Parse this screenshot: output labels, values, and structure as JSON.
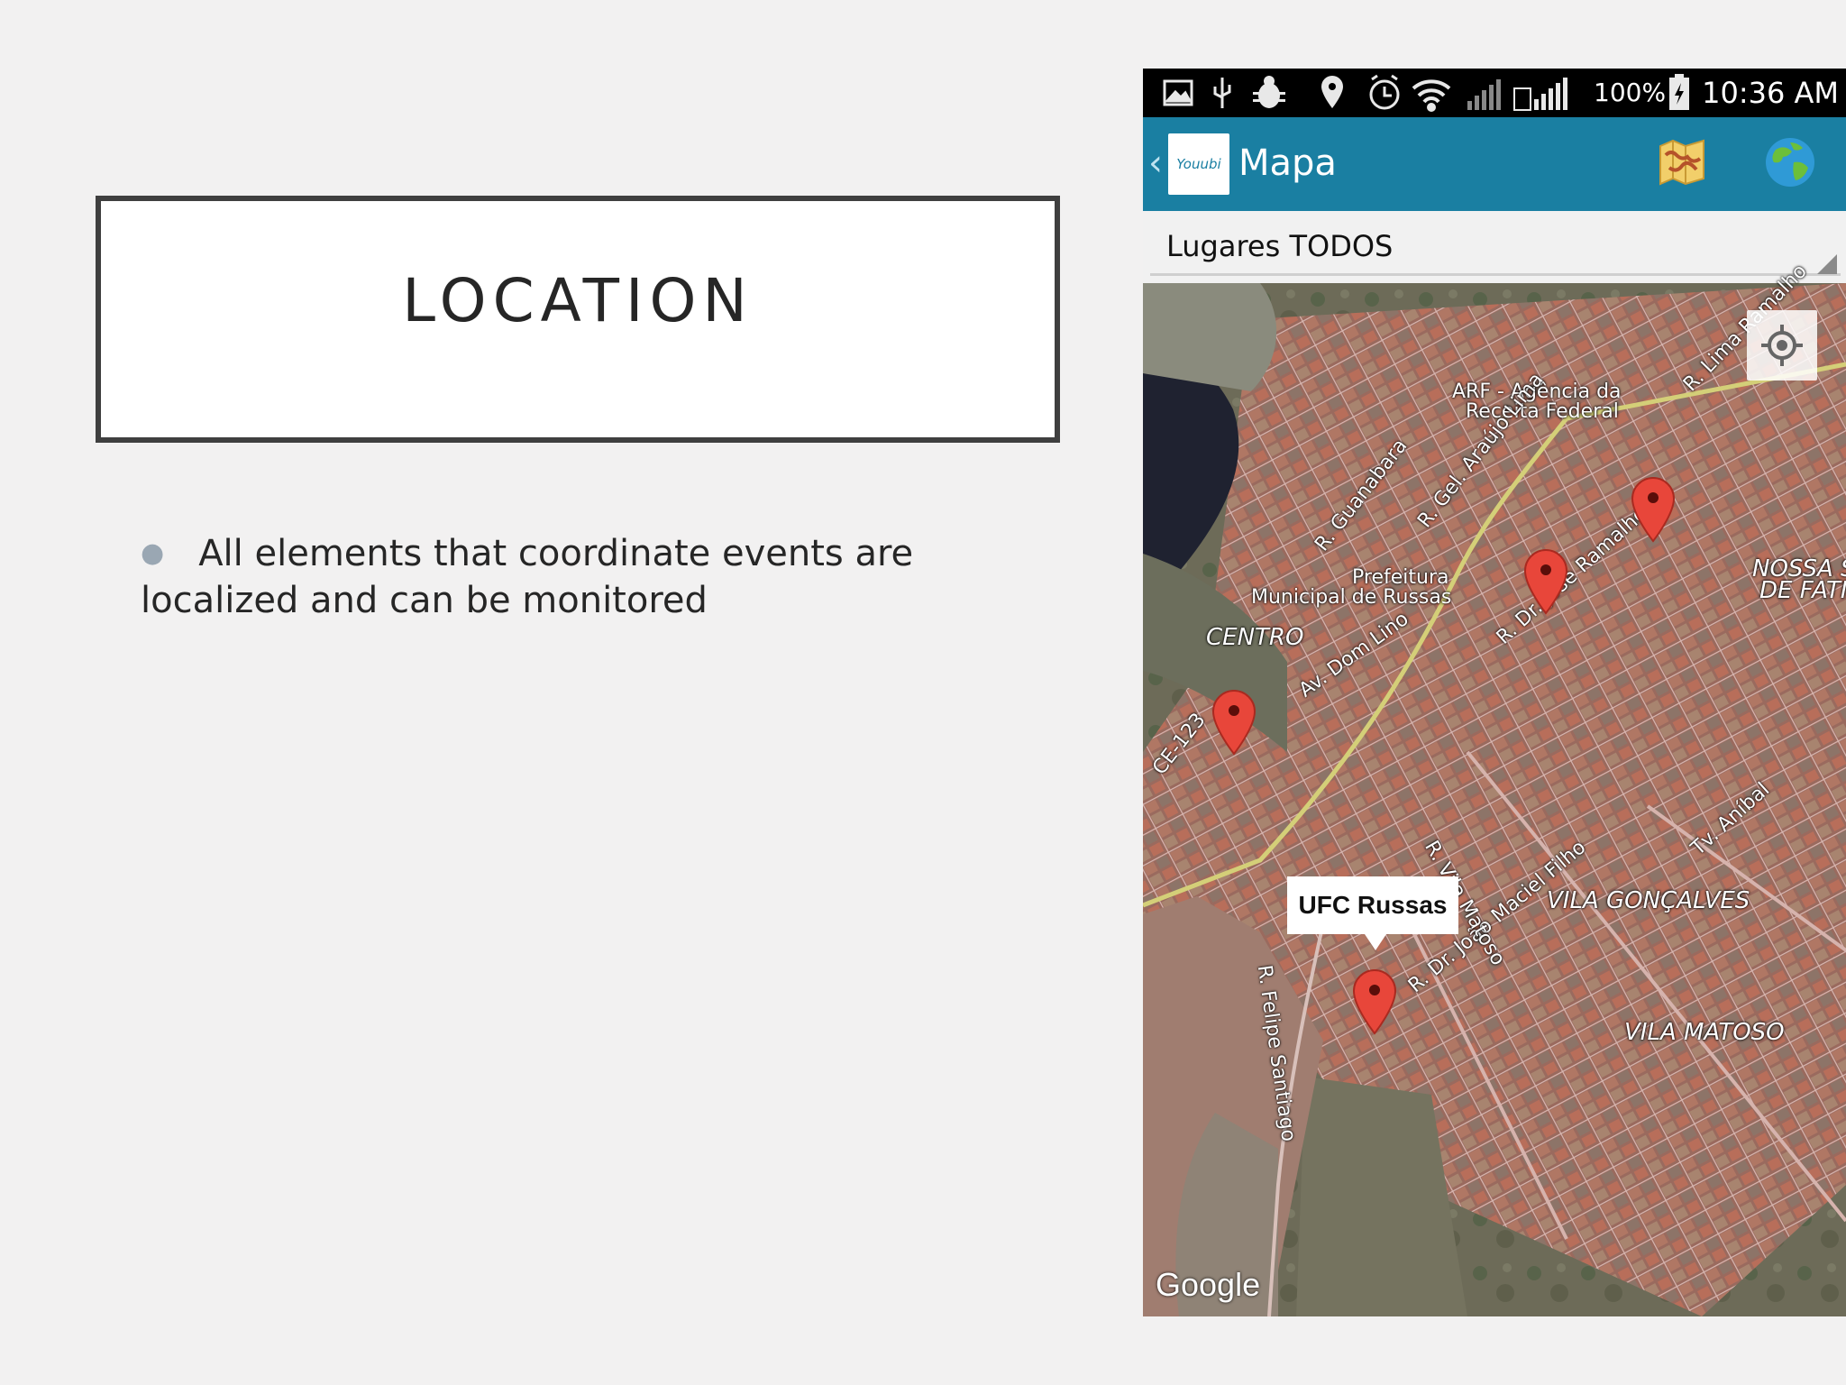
{
  "slide": {
    "title": "LOCATION",
    "bullets": [
      "All elements that coordinate events are localized and can be monitored"
    ]
  },
  "phone": {
    "status_bar": {
      "battery": "100%",
      "time": "10:36 AM",
      "icons": [
        "image-icon",
        "usb-icon",
        "bug-icon",
        "location-icon",
        "alarm-icon",
        "wifi-icon",
        "signal-1-icon",
        "signal-2-icon",
        "battery-charging-icon"
      ]
    },
    "app_bar": {
      "logo_text": "Youubi",
      "title": "Mapa",
      "actions": [
        "map-icon",
        "globe-icon"
      ]
    },
    "dropdown": {
      "selected": "Lugares TODOS"
    },
    "map": {
      "info_window": "UFC Russas",
      "attribution": "Google",
      "labels": {
        "arf": "ARF - Agência da",
        "arf2": "Receita Federal",
        "prefeitura": "Prefeitura",
        "prefeitura2": "Municipal de Russas",
        "centro": "CENTRO",
        "vila_goncalves": "VILA GONÇALVES",
        "vila_matoso": "VILA MATOSO",
        "nossa": "NOSSA S",
        "fatima": "DE FATI",
        "guanabara": "R. Guanabara",
        "gel_araujo": "R. Gel. Araújo Lima",
        "lima_ramalho": "R. Lima Ramalho",
        "jose_ramalho": "R. Dr. José Ramalho",
        "dom_lino": "Av. Dom Lino",
        "ce123": "CE-123",
        "joao_maciel": "R. Dr. João Maciel Filho",
        "vila_matoso_st": "R. Vila Matoso",
        "anibal": "Tv. Aníbal",
        "felipe_santiago": "R. Felipe Santiago"
      }
    }
  }
}
